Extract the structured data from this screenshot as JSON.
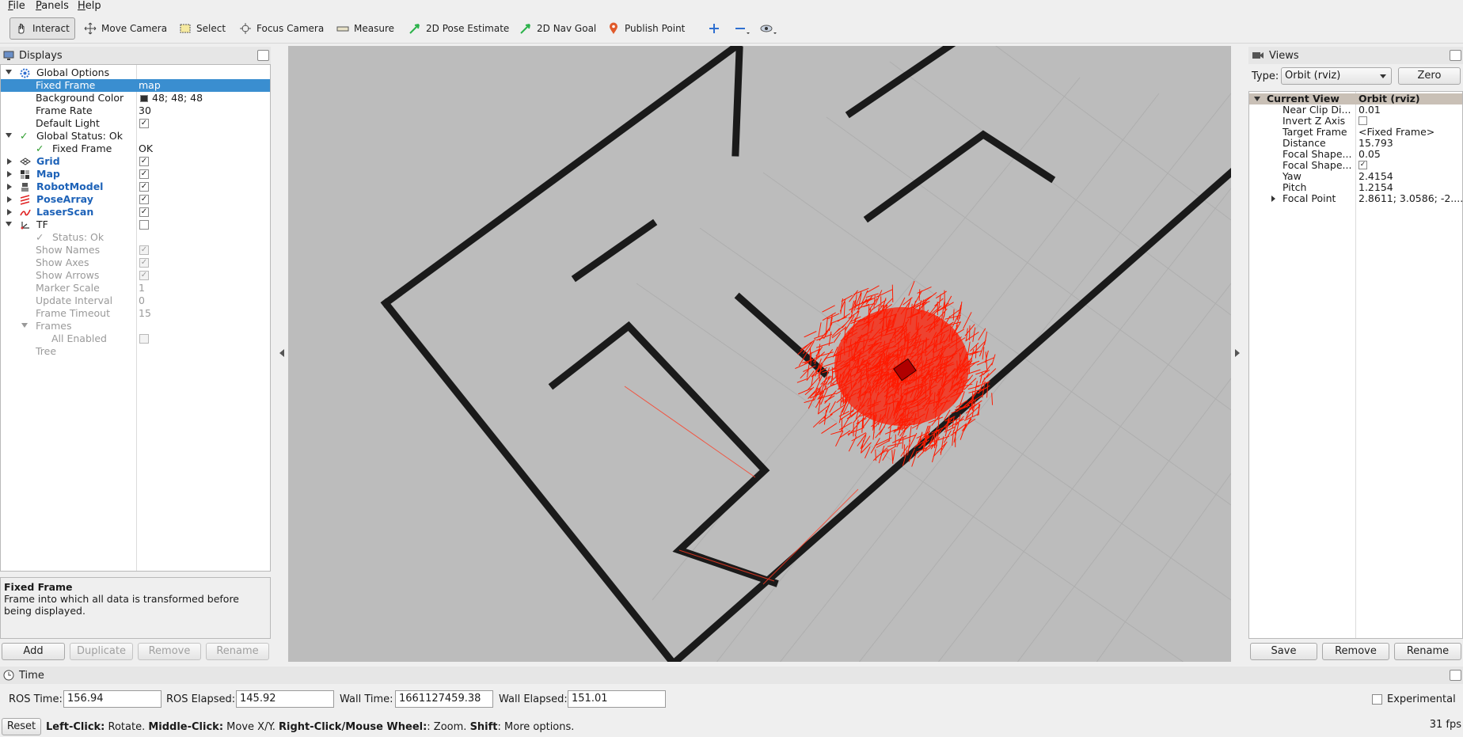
{
  "menu": [
    "File",
    "Panels",
    "Help"
  ],
  "toolbar": {
    "tools": [
      "Interact",
      "Move Camera",
      "Select",
      "Focus Camera",
      "Measure",
      "2D Pose Estimate",
      "2D Nav Goal",
      "Publish Point"
    ]
  },
  "displays": {
    "title": "Displays",
    "rows": [
      {
        "name": "Global Options",
        "value": ""
      },
      {
        "name": "Fixed Frame",
        "value": "map"
      },
      {
        "name": "Background Color",
        "value": "48; 48; 48"
      },
      {
        "name": "Frame Rate",
        "value": "30"
      },
      {
        "name": "Default Light",
        "value": ""
      },
      {
        "name": "Global Status: Ok",
        "value": ""
      },
      {
        "name": "Fixed Frame",
        "value": "OK"
      },
      {
        "name": "Grid",
        "value": ""
      },
      {
        "name": "Map",
        "value": ""
      },
      {
        "name": "RobotModel",
        "value": ""
      },
      {
        "name": "PoseArray",
        "value": ""
      },
      {
        "name": "LaserScan",
        "value": ""
      },
      {
        "name": "TF",
        "value": ""
      },
      {
        "name": "Status: Ok",
        "value": ""
      },
      {
        "name": "Show Names",
        "value": ""
      },
      {
        "name": "Show Axes",
        "value": ""
      },
      {
        "name": "Show Arrows",
        "value": ""
      },
      {
        "name": "Marker Scale",
        "value": "1"
      },
      {
        "name": "Update Interval",
        "value": "0"
      },
      {
        "name": "Frame Timeout",
        "value": "15"
      },
      {
        "name": "Frames",
        "value": ""
      },
      {
        "name": "All Enabled",
        "value": ""
      },
      {
        "name": "Tree",
        "value": ""
      }
    ],
    "description_title": "Fixed Frame",
    "description_text": "Frame into which all data is transformed before being displayed.",
    "buttons": {
      "add": "Add",
      "duplicate": "Duplicate",
      "remove": "Remove",
      "rename": "Rename"
    }
  },
  "views": {
    "title": "Views",
    "type_label": "Type:",
    "type_value": "Orbit (rviz)",
    "zero": "Zero",
    "header": {
      "name": "Current View",
      "value": "Orbit (rviz)"
    },
    "rows": [
      {
        "name": "Near Clip Di...",
        "value": "0.01"
      },
      {
        "name": "Invert Z Axis",
        "value": ""
      },
      {
        "name": "Target Frame",
        "value": "<Fixed Frame>"
      },
      {
        "name": "Distance",
        "value": "15.793"
      },
      {
        "name": "Focal Shape...",
        "value": "0.05"
      },
      {
        "name": "Focal Shape...",
        "value": ""
      },
      {
        "name": "Yaw",
        "value": "2.4154"
      },
      {
        "name": "Pitch",
        "value": "1.2154"
      },
      {
        "name": "Focal Point",
        "value": "2.8611; 3.0586; -2...."
      }
    ],
    "buttons": {
      "save": "Save",
      "remove": "Remove",
      "rename": "Rename"
    }
  },
  "time": {
    "title": "Time",
    "ros_time_label": "ROS Time:",
    "ros_time": "156.94",
    "ros_elapsed_label": "ROS Elapsed:",
    "ros_elapsed": "145.92",
    "wall_time_label": "Wall Time:",
    "wall_time": "1661127459.38",
    "wall_elapsed_label": "Wall Elapsed:",
    "wall_elapsed": "151.01",
    "experimental": "Experimental"
  },
  "status": {
    "reset": "Reset",
    "hint_parts": [
      "Left-Click:",
      " Rotate. ",
      "Middle-Click:",
      " Move X/Y. ",
      "Right-Click/Mouse Wheel:",
      ": Zoom. ",
      "Shift",
      ": More options."
    ],
    "fps": "31 fps"
  },
  "colors": {
    "selection": "#3a8ed0",
    "particles": "#ff1a00",
    "walls": "#1a1a1a",
    "floor": "#bcbcbc"
  }
}
